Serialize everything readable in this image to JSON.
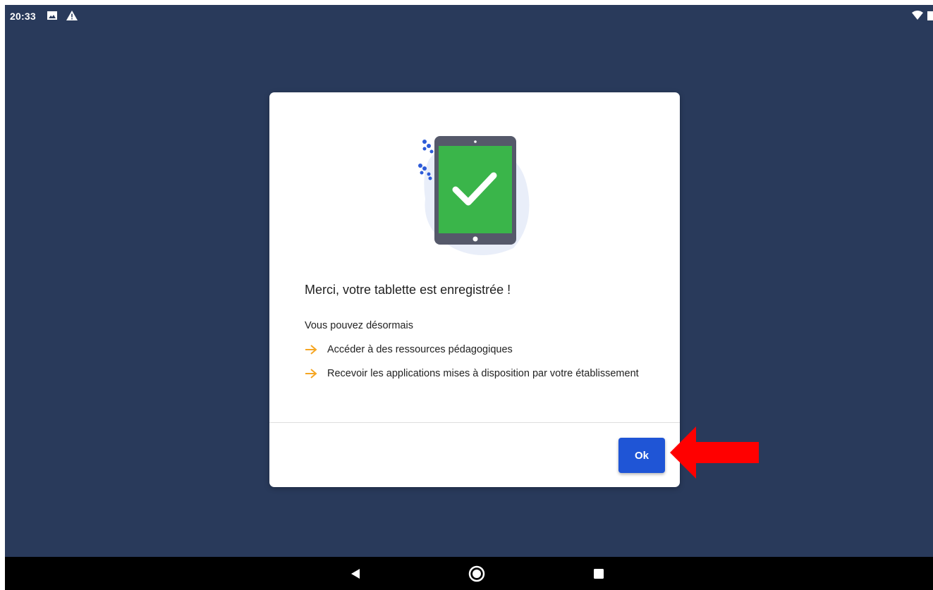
{
  "status_bar": {
    "time": "20:33",
    "icons": [
      "image-icon",
      "warning-icon",
      "wifi-icon",
      "battery-icon"
    ]
  },
  "dialog": {
    "illustration": "tablet-check-icon",
    "title": "Merci, votre tablette est enregistrée !",
    "intro": "Vous pouvez désormais",
    "benefits": [
      "Accéder à des ressources pédagogiques",
      "Recevoir les applications mises à disposition par votre établissement"
    ],
    "ok_label": "Ok"
  },
  "nav_bar": {
    "buttons": [
      "back-icon",
      "home-icon",
      "recents-icon"
    ]
  },
  "colors": {
    "background": "#293a5b",
    "primary": "#1f55d6",
    "arrow": "#f5a623",
    "annotation": "#ff0000",
    "screen_green": "#3ab54a"
  }
}
